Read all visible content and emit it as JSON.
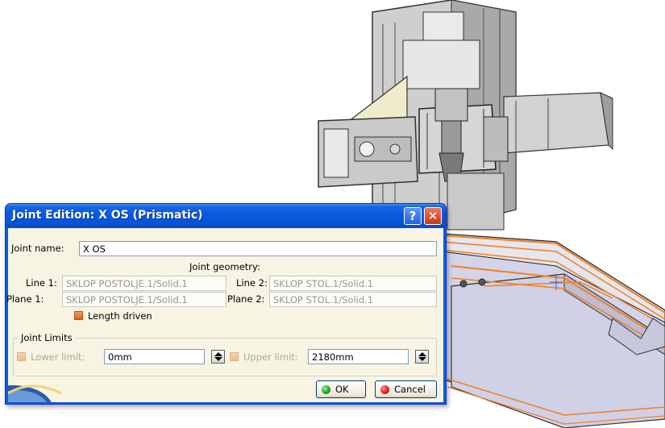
{
  "dialog": {
    "title": "Joint Edition: X OS (Prismatic)",
    "help_glyph": "?",
    "close_glyph": "✕"
  },
  "joint_name": {
    "label": "Joint name:",
    "value": "X OS"
  },
  "joint_geometry": {
    "heading": "Joint geometry:",
    "line1": {
      "label": "Line 1:",
      "value": "SKLOP POSTOLJE.1/Solid.1"
    },
    "line2": {
      "label": "Line 2:",
      "value": "SKLOP STOL.1/Solid.1"
    },
    "plane1": {
      "label": "Plane 1:",
      "value": "SKLOP POSTOLJE.1/Solid.1"
    },
    "plane2": {
      "label": "Plane 2:",
      "value": "SKLOP STOL.1/Solid.1"
    }
  },
  "length_driven": {
    "label": "Length driven",
    "checked": true
  },
  "joint_limits": {
    "legend": "Joint Limits",
    "lower": {
      "label": "Lower limit:",
      "value": "0mm",
      "checked": true
    },
    "upper": {
      "label": "Upper limit:",
      "value": "2180mm",
      "checked": true
    }
  },
  "buttons": {
    "ok": "OK",
    "cancel": "Cancel"
  },
  "colors": {
    "title_bar": "#0a58db",
    "dialog_body": "#f7f4e3",
    "checkbox": "#d3661a",
    "highlight_edges": "#f08020",
    "model_gray": "#c4c4c4"
  },
  "icons": {
    "help": "help-icon",
    "close": "close-icon",
    "ok": "green-dot-icon",
    "cancel": "red-dot-icon",
    "spinner": "spin-arrows-icon"
  }
}
